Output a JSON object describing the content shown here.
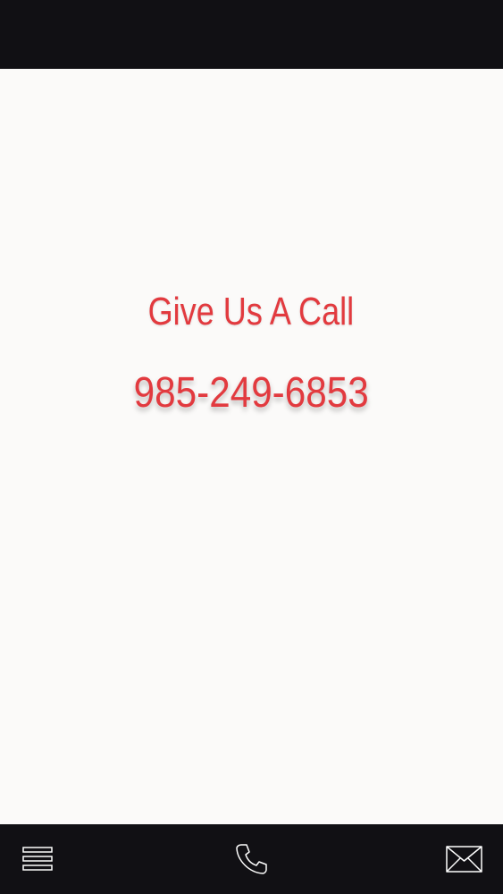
{
  "main": {
    "heading": "Give Us A Call",
    "phone": "985-249-6853"
  },
  "nav": {
    "items": [
      {
        "icon": "menu-icon"
      },
      {
        "icon": "phone-icon"
      },
      {
        "icon": "mail-icon"
      }
    ]
  },
  "colors": {
    "accent": "#e23a3f",
    "background": "#fbfaf9",
    "bars": "#111014"
  }
}
